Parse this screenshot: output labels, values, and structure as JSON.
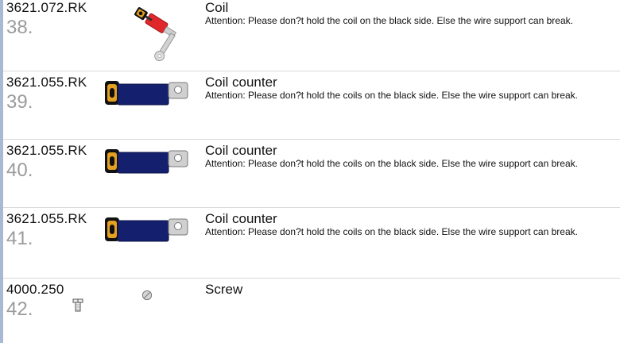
{
  "parts": [
    {
      "part_number": "3621.072.RK",
      "index": "38.",
      "title": "Coil",
      "note": "Attention: Please don?t hold the coil on the black side. Else the wire support can break.",
      "image": "coil-image"
    },
    {
      "part_number": "3621.055.RK",
      "index": "39.",
      "title": "Coil counter",
      "note": "Attention: Please don?t hold the coils on the black side. Else the wire support can break.",
      "image": "coil-counter-image"
    },
    {
      "part_number": "3621.055.RK",
      "index": "40.",
      "title": "Coil counter",
      "note": "Attention: Please don?t hold the coils on the black side. Else the wire support can break.",
      "image": "coil-counter-image"
    },
    {
      "part_number": "3621.055.RK",
      "index": "41.",
      "title": "Coil counter",
      "note": "Attention: Please don?t hold the coils on the black side. Else the wire support can break.",
      "image": "coil-counter-image"
    },
    {
      "part_number": "4000.250",
      "index": "42.",
      "title": "Screw",
      "note": "",
      "image": "screw-image"
    }
  ],
  "colors": {
    "accent_bar": "#a9b9d4",
    "coil_red": "#e0282a",
    "coil_counter_blue": "#14206e",
    "index_gray": "#9b9b9b"
  }
}
